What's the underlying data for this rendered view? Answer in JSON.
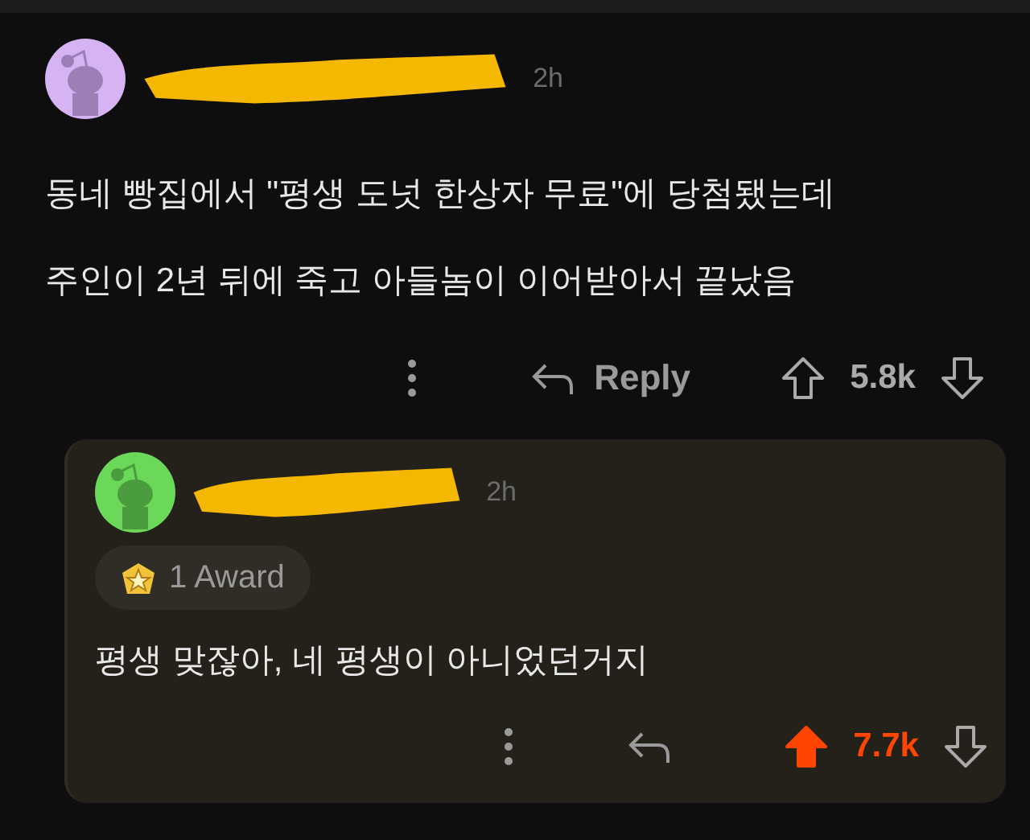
{
  "comment": {
    "time": "2h",
    "body": [
      "동네 빵집에서 \"평생 도넛 한상자 무료\"에 당첨됐는데",
      "주인이 2년 뒤에 죽고 아들놈이 이어받아서 끝났음"
    ],
    "actions": {
      "reply_label": "Reply",
      "score": "5.8k",
      "upvoted": false
    },
    "reply": {
      "time": "2h",
      "award": "1 Award",
      "body": [
        "평생 맞잖아, 네 평생이 아니었던거지"
      ],
      "actions": {
        "score": "7.7k",
        "upvoted": true
      }
    }
  }
}
